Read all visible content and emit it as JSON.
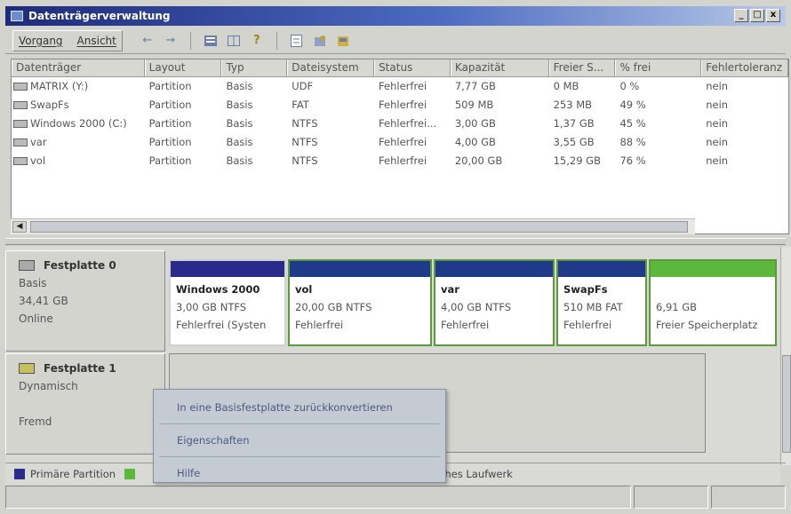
{
  "window": {
    "title": "Datenträgerverwaltung",
    "buttons": [
      "_",
      "□",
      "x"
    ]
  },
  "menu": {
    "items": [
      "Vorgang",
      "Ansicht"
    ]
  },
  "toolbar": {
    "icons": [
      "back-arrow-icon",
      "forward-arrow-icon",
      "view-list-icon",
      "view-grid-icon",
      "help-icon",
      "properties-icon",
      "settings-icon",
      "disk-icon"
    ]
  },
  "table": {
    "columns": [
      "Datenträger",
      "Layout",
      "Typ",
      "Dateisystem",
      "Status",
      "Kapazität",
      "Freier S...",
      "% frei",
      "Fehlertoleranz"
    ],
    "rows": [
      [
        "MATRIX (Y:)",
        "Partition",
        "Basis",
        "UDF",
        "Fehlerfrei",
        "7,77 GB",
        "0 MB",
        "0 %",
        "nein"
      ],
      [
        "SwapFs",
        "Partition",
        "Basis",
        "FAT",
        "Fehlerfrei",
        "509 MB",
        "253 MB",
        "49 %",
        "nein"
      ],
      [
        "Windows 2000 (C:)",
        "Partition",
        "Basis",
        "NTFS",
        "Fehlerfrei...",
        "3,00 GB",
        "1,37 GB",
        "45 %",
        "nein"
      ],
      [
        "var",
        "Partition",
        "Basis",
        "NTFS",
        "Fehlerfrei",
        "4,00 GB",
        "3,55 GB",
        "88 %",
        "nein"
      ],
      [
        "vol",
        "Partition",
        "Basis",
        "NTFS",
        "Fehlerfrei",
        "20,00 GB",
        "15,29 GB",
        "76 %",
        "nein"
      ]
    ]
  },
  "disk0": {
    "name": "Festplatte 0",
    "type": "Basis",
    "size": "34,41 GB",
    "state": "Online"
  },
  "volumes": [
    {
      "name": "Windows 2000",
      "size": "3,00 GB NTFS",
      "status": "Fehlerfrei (Systen"
    },
    {
      "name": "vol",
      "size": "20,00 GB NTFS",
      "status": "Fehlerfrei"
    },
    {
      "name": "var",
      "size": "4,00 GB NTFS",
      "status": "Fehlerfrei"
    },
    {
      "name": "SwapFs",
      "size": "510 MB FAT",
      "status": "Fehlerfrei"
    },
    {
      "name": "",
      "size": "6,91 GB",
      "status": "Freier Speicherplatz"
    }
  ],
  "disk1": {
    "name": "Festplatte 1",
    "type": "Dynamisch",
    "state": "Fremd"
  },
  "context_menu": {
    "items": [
      "In eine Basisfestplatte zurückkonvertieren",
      "Eigenschaften",
      "Hilfe"
    ]
  },
  "legend": {
    "primary": "Primäre Partition",
    "logical": "sches Laufwerk"
  },
  "colors": {
    "primary": "#2a2a8a",
    "free": "#5cb83c",
    "title_start": "#1f2a7a"
  }
}
